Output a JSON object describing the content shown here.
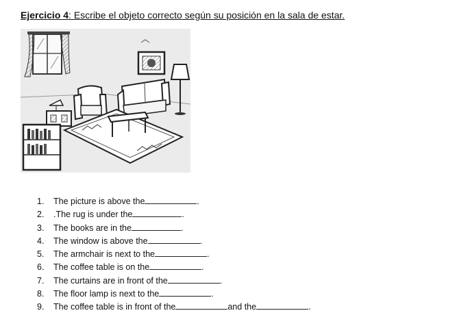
{
  "heading": {
    "label": "Ejercicio 4",
    "instruction": ": Escribe el objeto correcto según su posición en la sala de estar."
  },
  "illustration": {
    "icon": "living-room-sketch",
    "objects": [
      "window",
      "curtains",
      "picture",
      "floor-lamp",
      "sofa",
      "armchair",
      "side-table",
      "bookcase",
      "coffee-table",
      "rug"
    ]
  },
  "exercises": [
    {
      "num": "1.",
      "text": "The picture is above the",
      "end": "."
    },
    {
      "num": "2.",
      "text": ".The rug is under the",
      "end": "."
    },
    {
      "num": "3.",
      "text": "The books are in the",
      "end": "."
    },
    {
      "num": "4.",
      "text": "The window is above the",
      "end": "."
    },
    {
      "num": "5.",
      "text": "The armchair is next to the",
      "end": "."
    },
    {
      "num": "6.",
      "text": "The coffee table is on the",
      "end": "."
    },
    {
      "num": "7.",
      "text": "The curtains are in front of the",
      "end": "."
    },
    {
      "num": "8.",
      "text": "The floor lamp is next to the",
      "end": "."
    },
    {
      "num": "9.",
      "text": "The coffee table is in front of the",
      "middle": "and the",
      "end": "."
    }
  ]
}
